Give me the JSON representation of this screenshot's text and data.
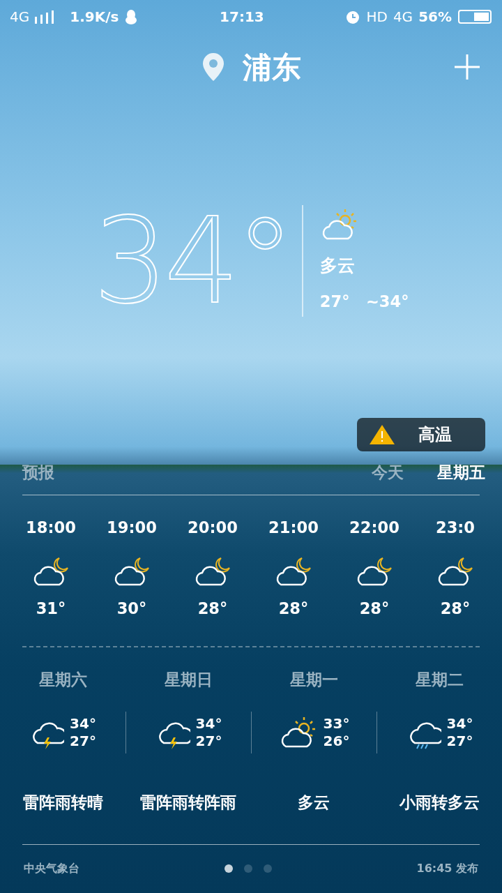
{
  "status_bar": {
    "network": "4G",
    "speed": "1.9K/s",
    "time": "17:13",
    "hd": "HD",
    "data": "4G",
    "battery": "56%"
  },
  "location": {
    "city": "浦东"
  },
  "current": {
    "temp": "34°",
    "kind": "partly-sunny",
    "condition": "多云",
    "range": "27°   ~34°"
  },
  "alert": {
    "text": "高温"
  },
  "forecast_header": {
    "title": "预报",
    "tabs": [
      {
        "label": "今天",
        "selected": false
      },
      {
        "label": "星期五",
        "selected": true
      }
    ]
  },
  "hourly": [
    {
      "time": "18:00",
      "kind": "moon-cloud",
      "temp": "31°"
    },
    {
      "time": "19:00",
      "kind": "moon-cloud",
      "temp": "30°"
    },
    {
      "time": "20:00",
      "kind": "moon-cloud",
      "temp": "28°"
    },
    {
      "time": "21:00",
      "kind": "moon-cloud",
      "temp": "28°"
    },
    {
      "time": "22:00",
      "kind": "moon-cloud",
      "temp": "28°"
    },
    {
      "time": "23:0",
      "kind": "moon-cloud",
      "temp": "28°"
    }
  ],
  "daily": [
    {
      "day": "星期六",
      "kind": "thunder",
      "high": "34°",
      "low": "27°",
      "condition": "雷阵雨转晴"
    },
    {
      "day": "星期日",
      "kind": "thunder",
      "high": "34°",
      "low": "27°",
      "condition": "雷阵雨转阵雨"
    },
    {
      "day": "星期一",
      "kind": "partly-sunny",
      "high": "33°",
      "low": "26°",
      "condition": "多云"
    },
    {
      "day": "星期二",
      "kind": "rain",
      "high": "34°",
      "low": "27°",
      "condition": "小雨转多云"
    }
  ],
  "footer": {
    "source": "中央气象台",
    "pages": [
      {
        "selected": true
      },
      {
        "selected": false
      },
      {
        "selected": false
      }
    ],
    "published": "16:45 发布"
  }
}
